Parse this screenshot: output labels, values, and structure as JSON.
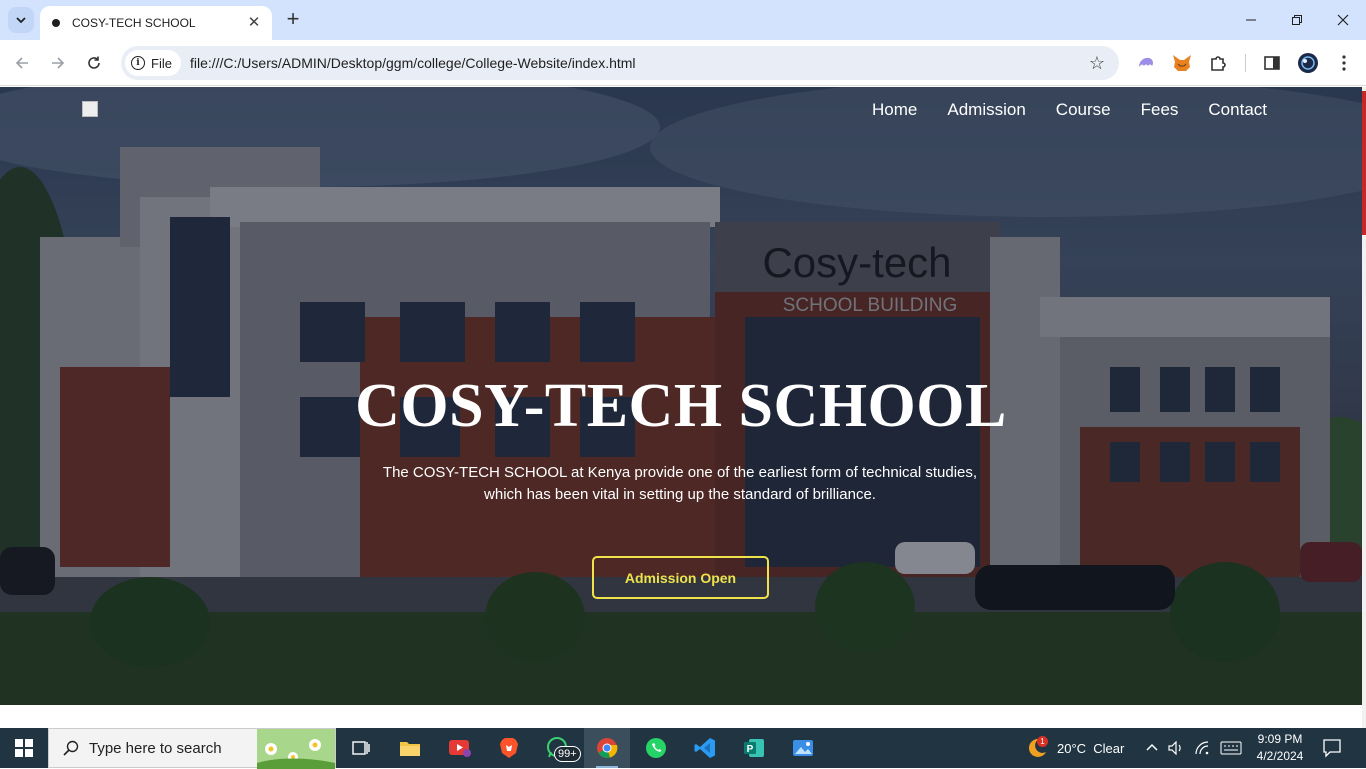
{
  "browser": {
    "tab_title": "COSY-TECH SCHOOL",
    "site_chip": "File",
    "url": "file:///C:/Users/ADMIN/Desktop/ggm/college/College-Website/index.html"
  },
  "page": {
    "nav": [
      "Home",
      "Admission",
      "Course",
      "Fees",
      "Contact"
    ],
    "building_sign_line1": "Cosy-tech",
    "building_sign_line2": "SCHOOL BUILDING",
    "hero_title": "COSY-TECH SCHOOL",
    "hero_desc_line1": "The COSY-TECH SCHOOL at Kenya provide one of the earliest form of technical studies,",
    "hero_desc_line2": "which has been vital in setting up the standard of brilliance.",
    "cta_label": "Admission Open"
  },
  "taskbar": {
    "search_placeholder": "Type here to search",
    "whatsapp_badge": "99+",
    "weather_badge": "1",
    "weather": "20°C  Clear",
    "time": "9:09 PM",
    "date": "4/2/2024"
  },
  "colors": {
    "tabbar": "#d3e3fd",
    "cta": "#f0e24a",
    "taskbar": "#203442"
  }
}
